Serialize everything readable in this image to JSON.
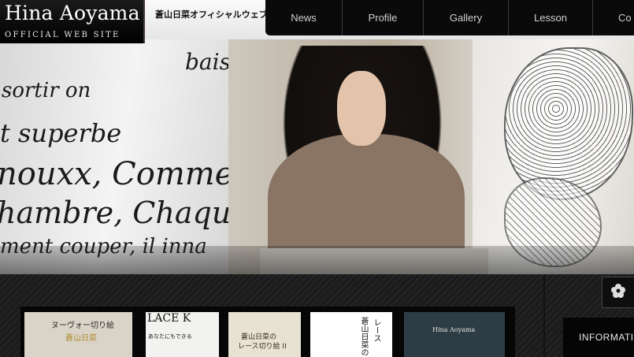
{
  "site": {
    "logo_name": "Hina Aoyama",
    "logo_sub": "OFFICIAL WEB SITE",
    "tagline": "蒼山日菜オフィシャルウェブサ"
  },
  "nav": {
    "items": [
      {
        "label": "News"
      },
      {
        "label": "Profile"
      },
      {
        "label": "Gallery"
      },
      {
        "label": "Lesson"
      },
      {
        "label": "Co"
      }
    ]
  },
  "hero": {
    "script_lines": [
      "baissing",
      "sortir on",
      "t superbe",
      "nouxx, Comme",
      "hambre, Chaqu",
      "ment couper, il inna"
    ]
  },
  "books": [
    {
      "title": "ヌーヴォー切り絵",
      "subtitle": "蒼山日菜",
      "bg": "#d9d4c7",
      "fg": "#2a2a2a"
    },
    {
      "title": "LACE K",
      "subtitle": "あなたにもできる",
      "bg": "#f2f2f0",
      "fg": "#111111"
    },
    {
      "title": "蒼山日菜の",
      "subtitle": "レース切り絵 II",
      "bg": "#e8e2d3",
      "fg": "#3a2a20"
    },
    {
      "title": "蒼山日菜の",
      "subtitle": "レース",
      "bg": "#ffffff",
      "fg": "#111111"
    },
    {
      "title": "Hina Aoyama",
      "subtitle": "",
      "bg": "#2e3d45",
      "fg": "#e0e0e0"
    }
  ],
  "sidebar": {
    "info_label": "INFORMATI",
    "icon_name": "flower-icon"
  },
  "colors": {
    "nav_bg": "#0a0a0a",
    "page_bg": "#1c1c1c",
    "nav_text": "#cfcfcf"
  }
}
